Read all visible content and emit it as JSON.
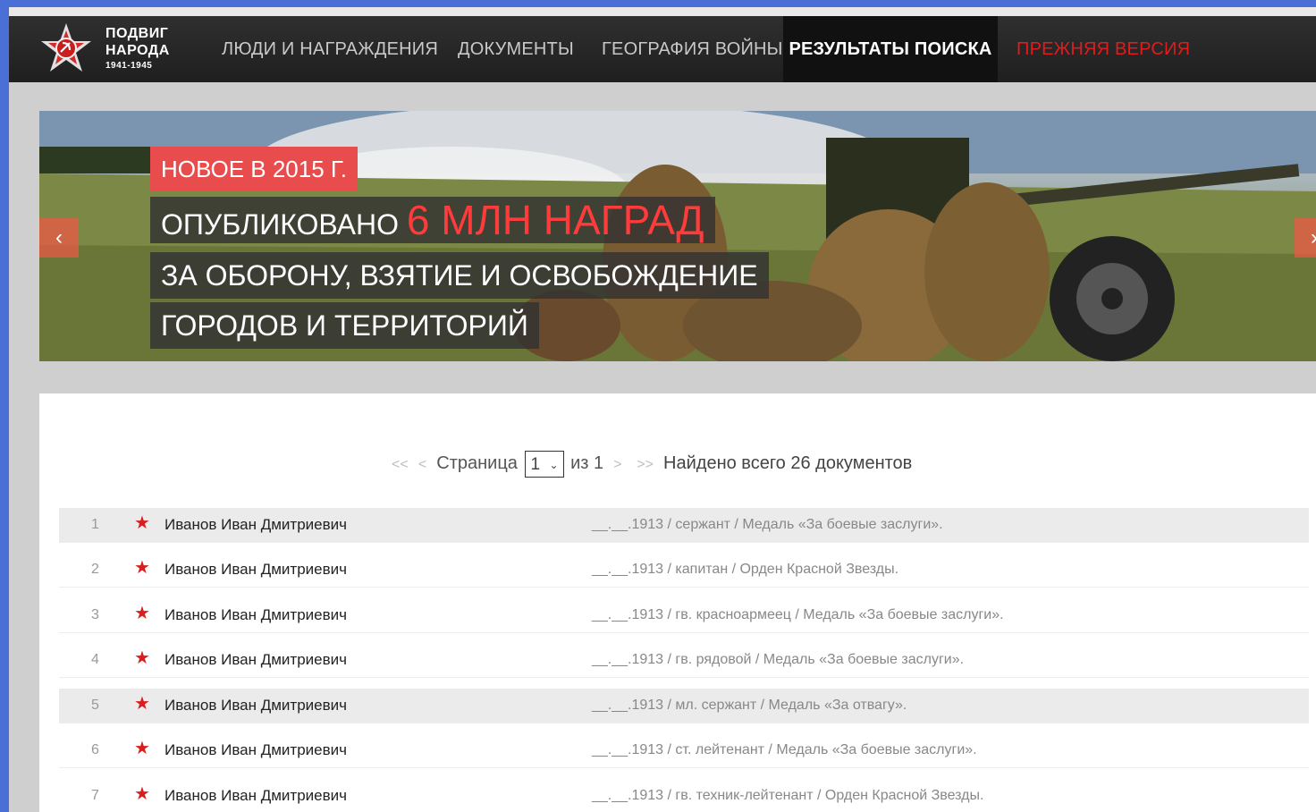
{
  "logo": {
    "line1": "ПОДВИГ",
    "line2": "НАРОДА",
    "years": "1941-1945"
  },
  "nav": {
    "people": "ЛЮДИ И НАГРАЖДЕНИЯ",
    "docs": "ДОКУМЕНТЫ",
    "geo": "ГЕОГРАФИЯ ВОЙНЫ",
    "results": "РЕЗУЛЬТАТЫ ПОИСКА",
    "old": "ПРЕЖНЯЯ ВЕРСИЯ"
  },
  "banner": {
    "tag": "НОВОЕ В 2015 Г.",
    "line1_prefix": "ОПУБЛИКОВАНО",
    "line1_accent": "6 МЛН НАГРАД",
    "line2": "ЗА ОБОРОНУ, ВЗЯТИЕ И ОСВОБОЖДЕНИЕ",
    "line3": "ГОРОДОВ И ТЕРРИТОРИЙ",
    "prev_icon": "chevron-left-icon",
    "next_icon": "chevron-right-icon"
  },
  "pager": {
    "first": "<<",
    "prev": "<",
    "page_label": "Страница",
    "current_page": "1",
    "of_label": "из 1",
    "next": ">",
    "last": ">>",
    "found": "Найдено всего 26 документов"
  },
  "results": [
    {
      "num": "1",
      "name": "Иванов Иван Дмитриевич",
      "info": "__.__.1913 /  сержант /  Медаль «За боевые заслуги»."
    },
    {
      "num": "2",
      "name": "Иванов Иван Дмитриевич",
      "info": "__.__.1913 /  капитан /  Орден Красной Звезды."
    },
    {
      "num": "3",
      "name": "Иванов Иван Дмитриевич",
      "info": "__.__.1913 /  гв. красноармеец /  Медаль «За боевые заслуги»."
    },
    {
      "num": "4",
      "name": "Иванов Иван Дмитриевич",
      "info": "__.__.1913 /  гв. рядовой /  Медаль «За боевые заслуги»."
    },
    {
      "num": "5",
      "name": "Иванов Иван Дмитриевич",
      "info": "__.__.1913 /  мл. сержант /  Медаль «За отвагу»."
    },
    {
      "num": "6",
      "name": "Иванов Иван Дмитриевич",
      "info": "__.__.1913 /  ст. лейтенант /  Медаль «За боевые заслуги»."
    },
    {
      "num": "7",
      "name": "Иванов Иван Дмитриевич",
      "info": "__.__.1913 /  гв. техник-лейтенант /  Орден Красной Звезды."
    }
  ],
  "colors": {
    "accent_red": "#e21b1b",
    "banner_tag": "#e84c4c",
    "nav_bg": "#2a2a2a"
  }
}
